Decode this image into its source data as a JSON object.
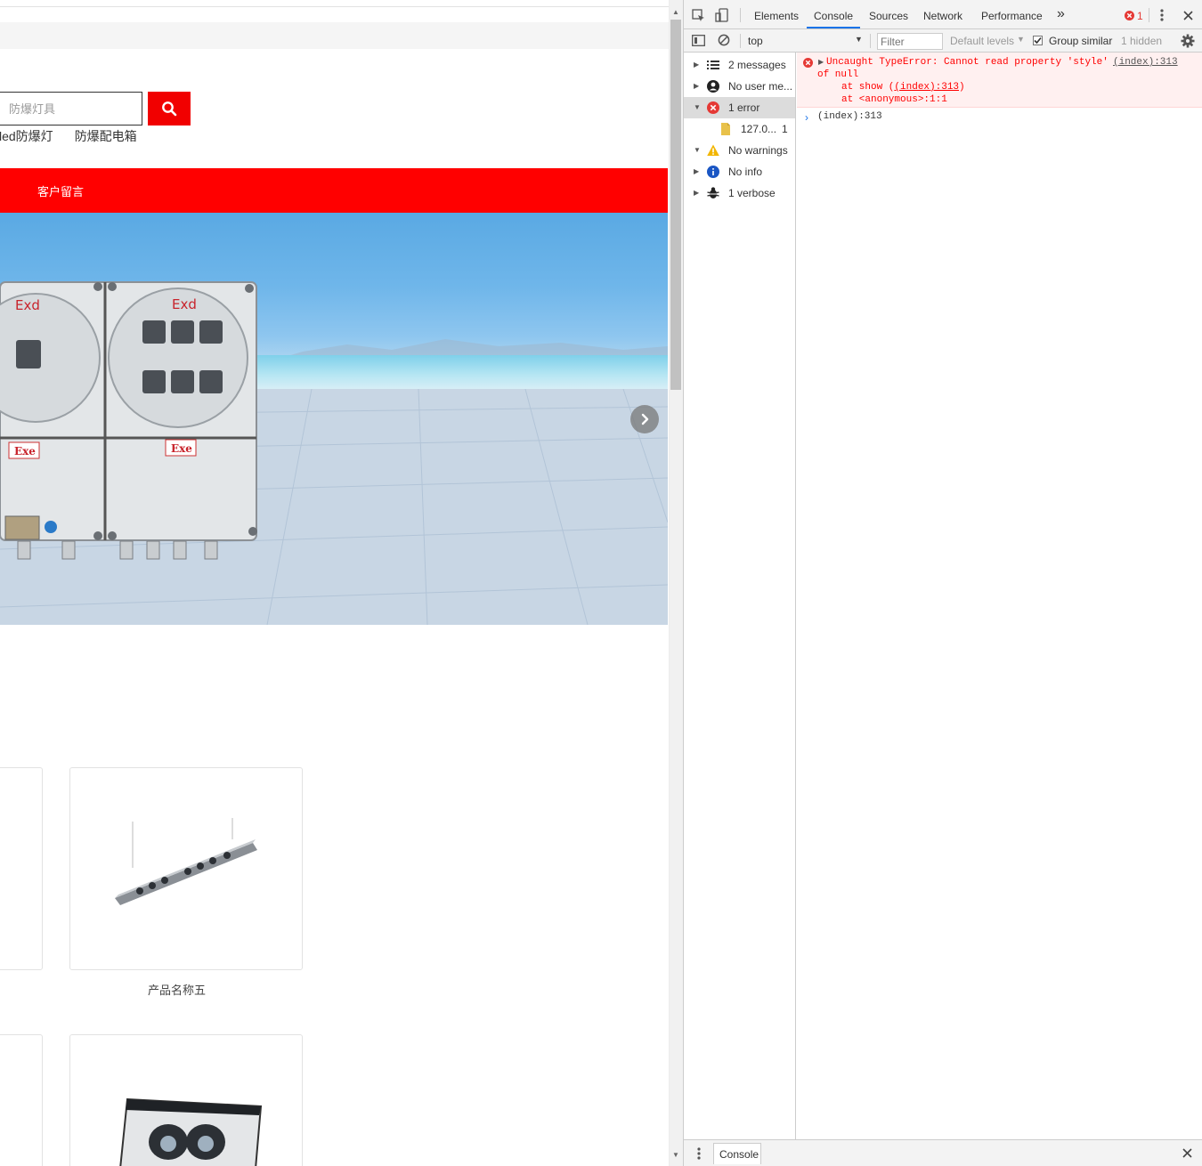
{
  "site": {
    "search_placeholder": "防爆灯具",
    "hot_words": [
      "led防爆灯",
      "防爆配电箱"
    ],
    "nav_item": "客户留言",
    "banner_labels": {
      "exd_1": "Exd",
      "exd_2": "Exd",
      "exe_1": "Exe",
      "exe_2": "Exe"
    },
    "products": [
      {
        "caption": "产品名称五"
      }
    ]
  },
  "devtools": {
    "tabs": [
      "Elements",
      "Console",
      "Sources",
      "Network",
      "Performance"
    ],
    "active_tab": "Console",
    "more_tabs": "»",
    "error_count": "1",
    "context": "top",
    "filter_placeholder": "Filter",
    "levels": "Default levels",
    "group_similar": "Group similar",
    "hidden": "1 hidden",
    "sidebar": [
      {
        "label": "2 messages",
        "icon": "list-icon"
      },
      {
        "label": "No user me...",
        "icon": "user-icon"
      },
      {
        "label": "1 error",
        "icon": "error-icon"
      },
      {
        "label": "127.0...",
        "count": "1",
        "icon": "file-icon"
      },
      {
        "label": "No warnings",
        "icon": "warning-icon"
      },
      {
        "label": "No info",
        "icon": "info-icon"
      },
      {
        "label": "1 verbose",
        "icon": "bug-icon"
      }
    ],
    "error": {
      "line1": "Uncaught TypeError: Cannot read property 'style'",
      "line2": "of null",
      "source": "(index):313",
      "stack1_pre": "at show (",
      "stack1_link": "(index):313",
      "stack1_post": ")",
      "stack2": "at <anonymous>:1:1"
    },
    "result_line": "(index):313",
    "drawer_tab": "Console"
  },
  "colors": {
    "brand_red": "#ff0000",
    "error_red": "#ff0000",
    "devtools_blue": "#1a73e8"
  }
}
